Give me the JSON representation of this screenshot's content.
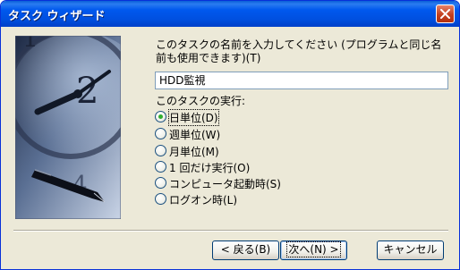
{
  "window": {
    "title": "タスク ウィザード",
    "close_icon": "close-icon"
  },
  "form": {
    "prompt_label": "このタスクの名前を入力してください (プログラムと同じ名前も使用できます)(T)",
    "task_name_value": "HDD監視",
    "exec_label": "このタスクの実行:",
    "options": [
      {
        "label": "日単位(D)",
        "selected": true
      },
      {
        "label": "週単位(W)",
        "selected": false
      },
      {
        "label": "月単位(M)",
        "selected": false
      },
      {
        "label": "1 回だけ実行(O)",
        "selected": false
      },
      {
        "label": "コンピュータ起動時(S)",
        "selected": false
      },
      {
        "label": "ログオン時(L)",
        "selected": false
      }
    ]
  },
  "buttons": {
    "back": "< 戻る(B)",
    "next": "次へ(N) >",
    "cancel": "キャンセル"
  },
  "colors": {
    "title_bar": "#0058ee",
    "dialog_bg": "#ece9d8",
    "close_button": "#c4401f",
    "radio_selected_dot": "#2fae2f"
  }
}
